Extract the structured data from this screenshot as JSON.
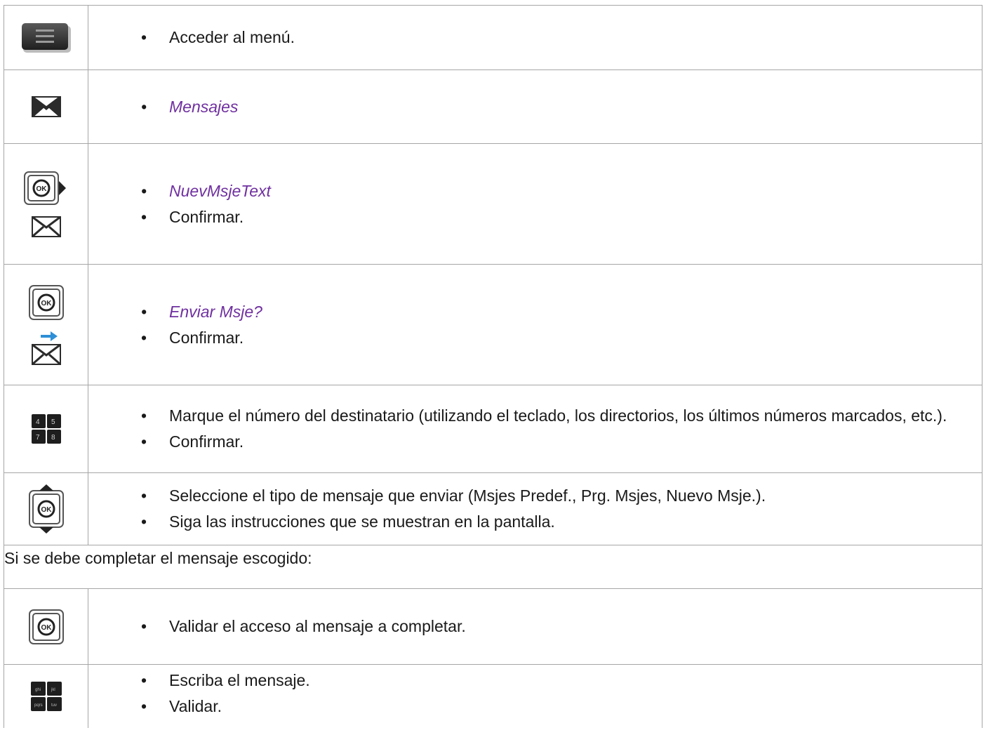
{
  "rows": [
    {
      "icon": "menu-key-icon",
      "items": [
        {
          "text": "Acceder al menú.",
          "keyword": false
        }
      ]
    },
    {
      "icon": "envelope-icon",
      "items": [
        {
          "text": "Mensajes",
          "keyword": true
        }
      ]
    },
    {
      "icon": "ok-right-arrow-key-icon",
      "icon2": "envelope-icon",
      "items": [
        {
          "text": "NuevMsjeText",
          "keyword": true
        },
        {
          "text": "Confirmar.",
          "keyword": false
        }
      ]
    },
    {
      "icon": "ok-key-icon",
      "icon2": "send-message-icon",
      "items": [
        {
          "text": "Enviar Msje?",
          "keyword": true
        },
        {
          "text": "Confirmar.",
          "keyword": false
        }
      ]
    },
    {
      "icon": "numeric-keypad-icon",
      "items": [
        {
          "text": "Marque el número del destinatario (utilizando el teclado, los directorios, los últimos números marcados, etc.).",
          "keyword": false
        },
        {
          "text": "Confirmar.",
          "keyword": false
        }
      ]
    },
    {
      "icon": "ok-up-down-navigation-icon",
      "items": [
        {
          "text": "Seleccione el tipo de mensaje que enviar (Msjes Predef., Prg. Msjes, Nuevo Msje.).",
          "keyword": false
        },
        {
          "text": "Siga las instrucciones que se muestran en la pantalla.",
          "keyword": false
        }
      ]
    }
  ],
  "note": "Si se debe completar el mensaje escogido:",
  "rows_after": [
    {
      "icon": "ok-key-icon",
      "items": [
        {
          "text": "Validar el acceso al mensaje a completar.",
          "keyword": false
        }
      ]
    },
    {
      "icon": "alpha-keypad-icon",
      "items": [
        {
          "text": "Escriba el mensaje.",
          "keyword": false
        },
        {
          "text": "Validar.",
          "keyword": false
        }
      ]
    }
  ],
  "keypad_numeric": [
    "4",
    "5",
    "7",
    "8"
  ],
  "keypad_alpha": [
    "ghi",
    "jkl",
    "pqrs",
    "tuv"
  ],
  "colors": {
    "keyword": "#7030a0",
    "border": "#a6a6a6",
    "arrow_blue": "#2e8fd6"
  }
}
